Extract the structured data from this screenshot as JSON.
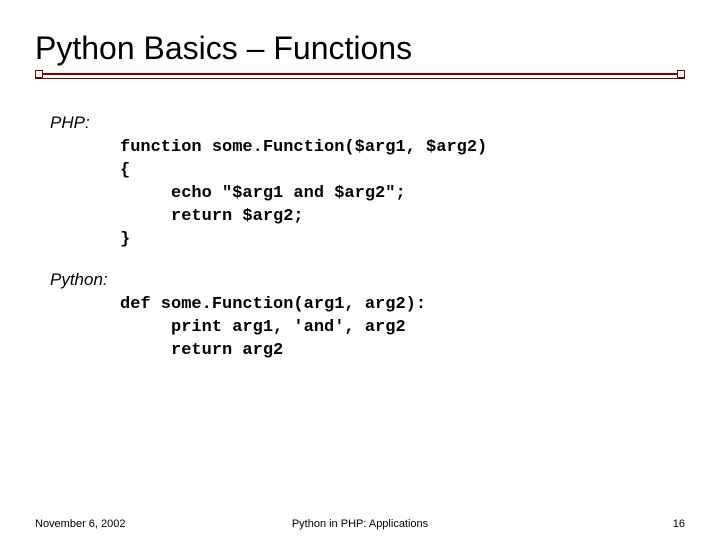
{
  "title": "Python Basics – Functions",
  "sections": {
    "php": {
      "label": "PHP:",
      "code": "function some.Function($arg1, $arg2)\n{\n     echo \"$arg1 and $arg2\";\n     return $arg2;\n}"
    },
    "python": {
      "label": "Python:",
      "code": "def some.Function(arg1, arg2):\n     print arg1, 'and', arg2\n     return arg2"
    }
  },
  "footer": {
    "date": "November 6, 2002",
    "center": "Python in PHP: Applications",
    "page": "16"
  }
}
